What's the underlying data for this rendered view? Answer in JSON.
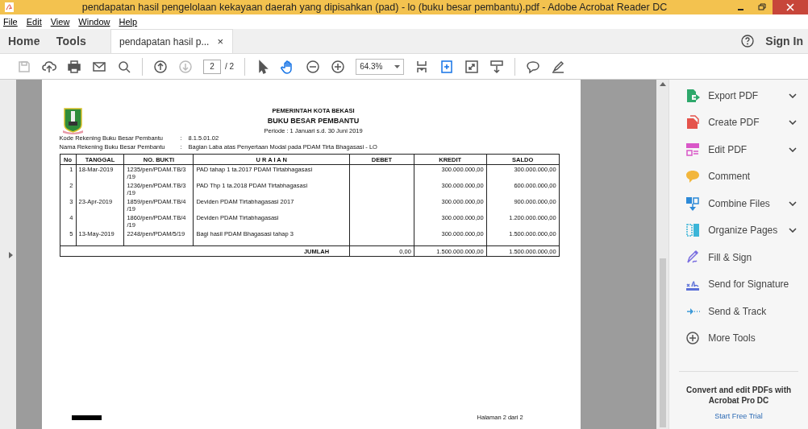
{
  "window": {
    "title": "pendapatan hasil pengelolaan kekayaan daerah yang dipisahkan (pad) - lo (buku besar pembantu).pdf - Adobe Acrobat Reader DC"
  },
  "menu": [
    {
      "label": "File"
    },
    {
      "label": "Edit"
    },
    {
      "label": "View"
    },
    {
      "label": "Window"
    },
    {
      "label": "Help"
    }
  ],
  "nav_tabs": [
    {
      "label": "Home"
    },
    {
      "label": "Tools"
    }
  ],
  "doc_tab": {
    "label": "pendapatan hasil p...",
    "close": "×"
  },
  "sign_in": "Sign In",
  "toolbar": [
    {
      "kind": "save",
      "disabled": true
    },
    {
      "kind": "upload",
      "disabled": false
    },
    {
      "kind": "print",
      "disabled": false
    },
    {
      "kind": "mail",
      "disabled": false
    },
    {
      "kind": "search",
      "disabled": false
    },
    {
      "kind": "sep"
    },
    {
      "kind": "up",
      "disabled": false
    },
    {
      "kind": "down",
      "disabled": true
    },
    {
      "kind": "page"
    },
    {
      "kind": "sep"
    },
    {
      "kind": "cursor",
      "selected": false
    },
    {
      "kind": "hand",
      "selected": true
    },
    {
      "kind": "zoomout",
      "disabled": false
    },
    {
      "kind": "zoomin",
      "disabled": false
    },
    {
      "kind": "zoom"
    },
    {
      "kind": "fit",
      "disabled": false
    },
    {
      "kind": "fitwidth"
    },
    {
      "kind": "fullscreen",
      "disabled": false
    },
    {
      "kind": "read",
      "disabled": false
    },
    {
      "kind": "sep"
    },
    {
      "kind": "comment",
      "disabled": false
    },
    {
      "kind": "pen",
      "disabled": false
    }
  ],
  "page_field": {
    "value": "2",
    "total": "/ 2"
  },
  "zoom_field": {
    "value": "64.3%"
  },
  "document": {
    "header": [
      "PEMERINTAH KOTA BEKASI",
      "BUKU BESAR PEMBANTU",
      "Periode : 1 Januari s.d. 30 Juni 2019"
    ],
    "info": [
      {
        "label": "Kode Rekening Buku Besar Pembantu",
        "sep": ":",
        "value": "8.1.5.01.02"
      },
      {
        "label": "Nama Rekening Buku Besar Pembantu",
        "sep": ":",
        "value": "Bagian Laba atas Penyertaan Modal pada PDAM Tirta Bhagasasi - LO"
      }
    ],
    "columns": [
      "No",
      "TANGGAL",
      "NO. BUKTI",
      "U R A I A N",
      "DEBET",
      "KREDIT",
      "SALDO"
    ],
    "rows": [
      [
        "1",
        "18-Mar-2019",
        "1235/pen/PDAM.TB/3\n/19",
        "PAD tahap 1 ta.2017 PDAM Tirtabhagasasi",
        "",
        "300.000.000,00",
        "300.000.000,00"
      ],
      [
        "2",
        "",
        "1236/pen/PDAM.TB/3\n/19",
        "PAD Thp 1 ta.2018 PDAM Tirtabhagasasi",
        "",
        "300.000.000,00",
        "600.000.000,00"
      ],
      [
        "3",
        "23-Apr-2019",
        "1859/pen/PDAM.TB/4\n/19",
        "Deviden PDAM Tirtabhagasasi 2017",
        "",
        "300.000.000,00",
        "900.000.000,00"
      ],
      [
        "4",
        "",
        "1860/pen/PDAM.TB/4\n/19",
        "Deviden PDAM Tirtabhagasasi",
        "",
        "300.000.000,00",
        "1.200.000.000,00"
      ],
      [
        "5",
        "13-May-2019",
        "2248/pen/PDAM/5/19",
        "Bagi hasil PDAM Bhagasasi tahap 3",
        "",
        "300.000.000,00",
        "1.500.000.000,00"
      ]
    ],
    "total": {
      "label": "JUMLAH",
      "debet": "0,00",
      "kredit": "1.500.000.000,00",
      "saldo": "1.500.000.000,00"
    },
    "page_number": "Halaman 2 dari 2"
  },
  "tools": [
    {
      "label": "Export PDF",
      "kind": "export",
      "color": "#2ea86b",
      "expandable": true
    },
    {
      "label": "Create PDF",
      "kind": "create",
      "color": "#e5534b",
      "expandable": true
    },
    {
      "label": "Edit PDF",
      "kind": "edit",
      "color": "#d957c8",
      "expandable": true
    },
    {
      "label": "Comment",
      "kind": "comment",
      "color": "#f2b63c",
      "expandable": false
    },
    {
      "label": "Combine Files",
      "kind": "combine",
      "color": "#2d8ad8",
      "expandable": true
    },
    {
      "label": "Organize Pages",
      "kind": "organize",
      "color": "#3bb5d8",
      "expandable": true
    },
    {
      "label": "Fill & Sign",
      "kind": "fill",
      "color": "#7a6ee0",
      "expandable": false
    },
    {
      "label": "Send for Signature",
      "kind": "signature",
      "color": "#5a6fd8",
      "expandable": false
    },
    {
      "label": "Send & Track",
      "kind": "track",
      "color": "#3d9ad8",
      "expandable": false
    },
    {
      "label": "More Tools",
      "kind": "more",
      "color": "#555555",
      "expandable": false
    }
  ],
  "promo": {
    "text": "Convert and edit PDFs with Acrobat Pro DC",
    "link": "Start Free Trial"
  }
}
